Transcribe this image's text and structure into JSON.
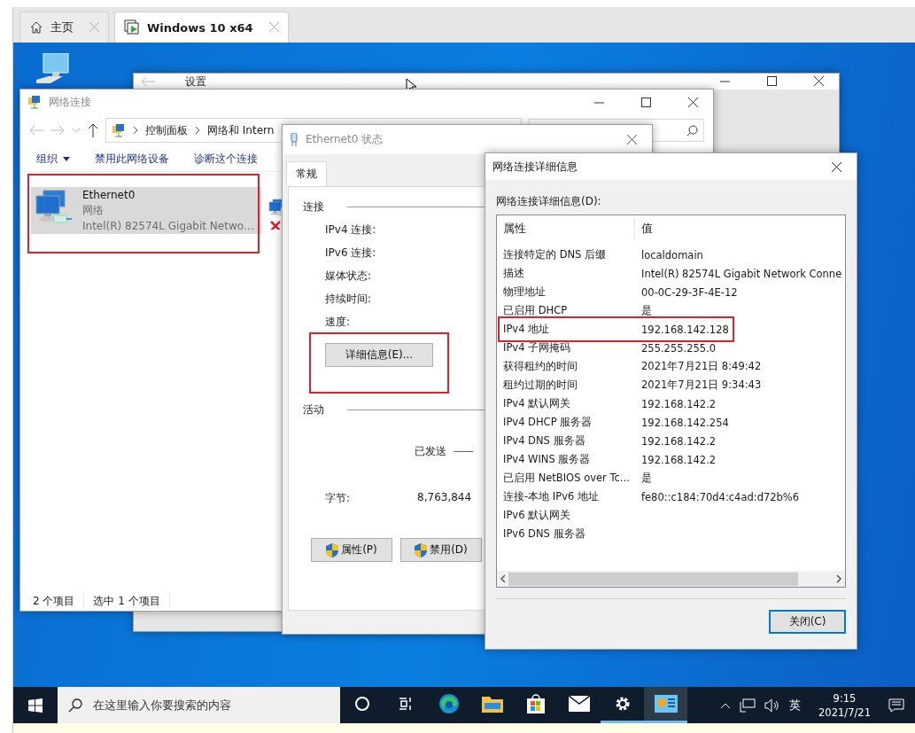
{
  "vm_tabs": [
    {
      "label": "主页",
      "kind": "home",
      "selected": false
    },
    {
      "label": "Windows 10 x64",
      "kind": "vm",
      "selected": true
    }
  ],
  "settings_window": {
    "title": "设置"
  },
  "network_window": {
    "title": "网络连接",
    "breadcrumb": [
      "控制面板",
      "网络和 Intern"
    ],
    "toolbar": [
      {
        "label": "组织",
        "kind": "menu"
      },
      {
        "label": "禁用此网络设备",
        "kind": "command"
      },
      {
        "label": "诊断这个连接",
        "kind": "command"
      }
    ],
    "connections": [
      {
        "name": "Ethernet0",
        "network": "网络",
        "device": "Intel(R) 82574L Gigabit Netwo…",
        "selected": true,
        "disconnected": false,
        "annotated": true
      },
      {
        "selected": false,
        "disconnected": true,
        "annotated": false
      }
    ],
    "status": [
      "2 个项目",
      "选中 1 个项目"
    ]
  },
  "status_dialog": {
    "title": "Ethernet0 状态",
    "tabs": [
      {
        "label": "常规",
        "selected": true
      }
    ],
    "connection_group": "连接",
    "connection_fields": [
      "IPv4 连接:",
      "IPv6 连接:",
      "媒体状态:",
      "持续时间:",
      "速度:"
    ],
    "details_button": {
      "label": "详细信息(E)...",
      "annotated": true
    },
    "activity_group": "活动",
    "sent_label": "已发送",
    "bytes_label": "字节:",
    "bytes_sent": "8,763,844",
    "buttons": [
      "属性(P)",
      "禁用(D)"
    ]
  },
  "details_dialog": {
    "title": "网络连接详细信息",
    "list_label": "网络连接详细信息(D):",
    "columns": [
      "属性",
      "值"
    ],
    "rows": [
      {
        "property": "连接特定的 DNS 后缀",
        "value": "localdomain",
        "annotated": false
      },
      {
        "property": "描述",
        "value": "Intel(R) 82574L Gigabit Network Conne",
        "annotated": false
      },
      {
        "property": "物理地址",
        "value": "00-0C-29-3F-4E-12",
        "annotated": false
      },
      {
        "property": "已启用 DHCP",
        "value": "是",
        "annotated": false
      },
      {
        "property": "IPv4 地址",
        "value": "192.168.142.128",
        "annotated": true
      },
      {
        "property": "IPv4 子网掩码",
        "value": "255.255.255.0",
        "annotated": false
      },
      {
        "property": "获得租约的时间",
        "value": "2021年7月21日 8:49:42",
        "annotated": false
      },
      {
        "property": "租约过期的时间",
        "value": "2021年7月21日 9:34:43",
        "annotated": false
      },
      {
        "property": "IPv4 默认网关",
        "value": "192.168.142.2",
        "annotated": false
      },
      {
        "property": "IPv4 DHCP 服务器",
        "value": "192.168.142.254",
        "annotated": false
      },
      {
        "property": "IPv4 DNS 服务器",
        "value": "192.168.142.2",
        "annotated": false
      },
      {
        "property": "IPv4 WINS 服务器",
        "value": "192.168.142.2",
        "annotated": false
      },
      {
        "property": "已启用 NetBIOS over Tc...",
        "value": "是",
        "annotated": false
      },
      {
        "property": "连接-本地 IPv6 地址",
        "value": "fe80::c184:70d4:c4ad:d72b%6",
        "annotated": false
      },
      {
        "property": "IPv6 默认网关",
        "value": "",
        "annotated": false
      },
      {
        "property": "IPv6 DNS 服务器",
        "value": "",
        "annotated": false
      }
    ],
    "close_button": "关闭(C)"
  },
  "taskbar": {
    "search_placeholder": "在这里输入你要搜索的内容",
    "apps": [
      {
        "kind": "cortana",
        "running": false,
        "selected": false
      },
      {
        "kind": "task-view",
        "running": false,
        "selected": false
      },
      {
        "kind": "edge",
        "running": false,
        "selected": false
      },
      {
        "kind": "explorer",
        "running": false,
        "selected": false
      },
      {
        "kind": "store",
        "running": false,
        "selected": false
      },
      {
        "kind": "mail",
        "running": false,
        "selected": false
      },
      {
        "kind": "settings",
        "running": true,
        "selected": false
      },
      {
        "kind": "control-panel",
        "running": true,
        "selected": true
      }
    ],
    "ime": "英",
    "time": "9:15",
    "date": "2021/7/21"
  }
}
